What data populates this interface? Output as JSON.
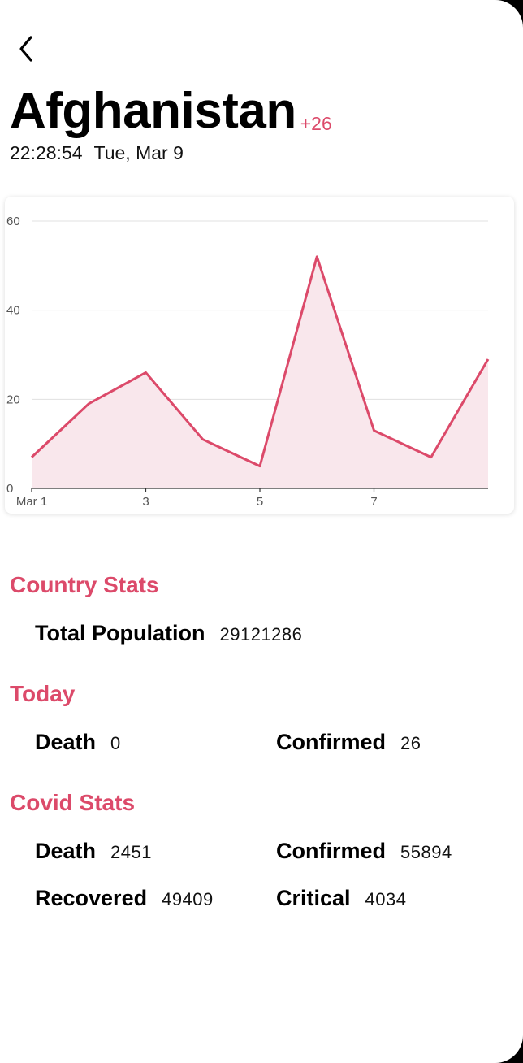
{
  "header": {
    "country": "Afghanistan",
    "delta": "+26",
    "time": "22:28:54",
    "date": "Tue, Mar 9"
  },
  "icons": {
    "back": "chevron-left-icon"
  },
  "colors": {
    "accent": "#dc4a6a",
    "area_fill": "#f9e7ec",
    "gridline": "#e0e0e0"
  },
  "chart_data": {
    "type": "area",
    "x": [
      1,
      2,
      3,
      4,
      5,
      6,
      7,
      8,
      9
    ],
    "y_ticks": [
      "0",
      "20",
      "40",
      "60"
    ],
    "x_tick_positions": [
      1,
      3,
      5,
      7
    ],
    "x_tick_labels": [
      "Mar 1",
      "3",
      "5",
      "7"
    ],
    "series": [
      {
        "values": [
          7,
          19,
          26,
          11,
          5,
          52,
          13,
          7,
          29
        ]
      }
    ],
    "ylim": [
      0,
      60
    ],
    "xlim": [
      1,
      9
    ],
    "grid": true
  },
  "sections": {
    "country_stats": {
      "title": "Country Stats",
      "population_label": "Total Population",
      "population_value": "29121286"
    },
    "today": {
      "title": "Today",
      "death_label": "Death",
      "death_value": "0",
      "confirmed_label": "Confirmed",
      "confirmed_value": "26"
    },
    "covid_stats": {
      "title": "Covid Stats",
      "death_label": "Death",
      "death_value": "2451",
      "confirmed_label": "Confirmed",
      "confirmed_value": "55894",
      "recovered_label": "Recovered",
      "recovered_value": "49409",
      "critical_label": "Critical",
      "critical_value": "4034"
    }
  }
}
